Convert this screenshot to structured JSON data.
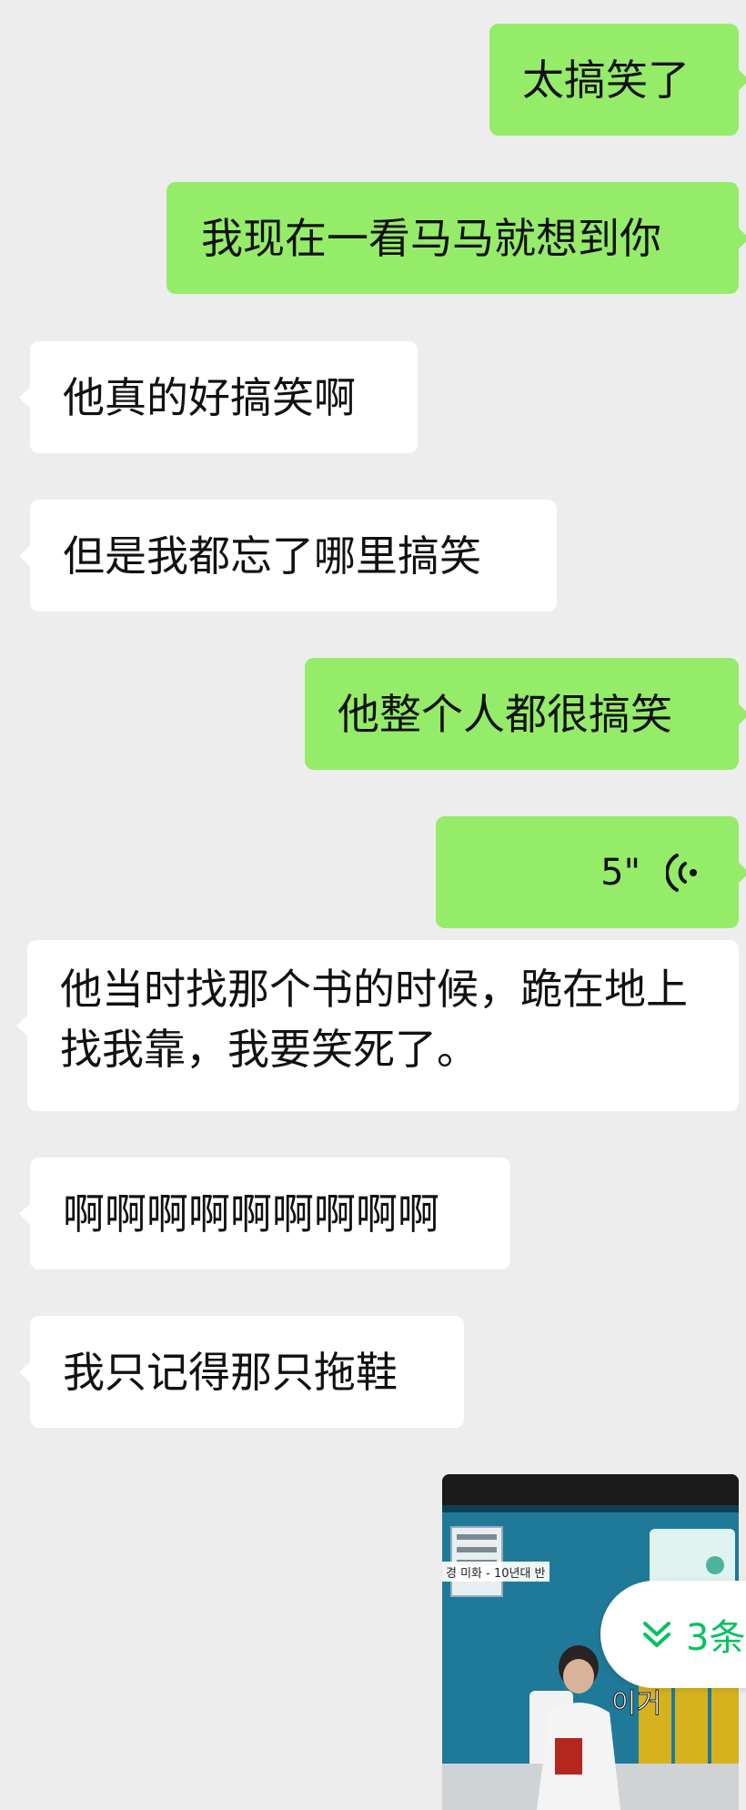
{
  "messages": [
    {
      "side": "sent",
      "type": "text",
      "text": "太搞笑了"
    },
    {
      "side": "sent",
      "type": "text",
      "text": "我现在一看马马就想到你"
    },
    {
      "side": "received",
      "type": "text",
      "text": "他真的好搞笑啊"
    },
    {
      "side": "received",
      "type": "text",
      "text": "但是我都忘了哪里搞笑"
    },
    {
      "side": "sent",
      "type": "text",
      "text": "他整个人都很搞笑"
    },
    {
      "side": "sent",
      "type": "voice",
      "duration": "5\""
    },
    {
      "side": "received",
      "type": "text",
      "text": "他当时找那个书的时候，跪在地上找我靠，我要笑死了。"
    },
    {
      "side": "received",
      "type": "text",
      "text": "啊啊啊啊啊啊啊啊啊"
    },
    {
      "side": "received",
      "type": "text",
      "text": "我只记得那只拖鞋"
    },
    {
      "side": "sent",
      "type": "image",
      "caption_overlay": "경 미화 - 10년대 반",
      "subtitle_overlay": "이거"
    }
  ],
  "new_messages_pill": {
    "text": "3条",
    "icon": "double-chevron-down-icon"
  },
  "colors": {
    "background": "#ededed",
    "sent_bubble": "#95ec69",
    "received_bubble": "#ffffff",
    "accent": "#07c160"
  }
}
